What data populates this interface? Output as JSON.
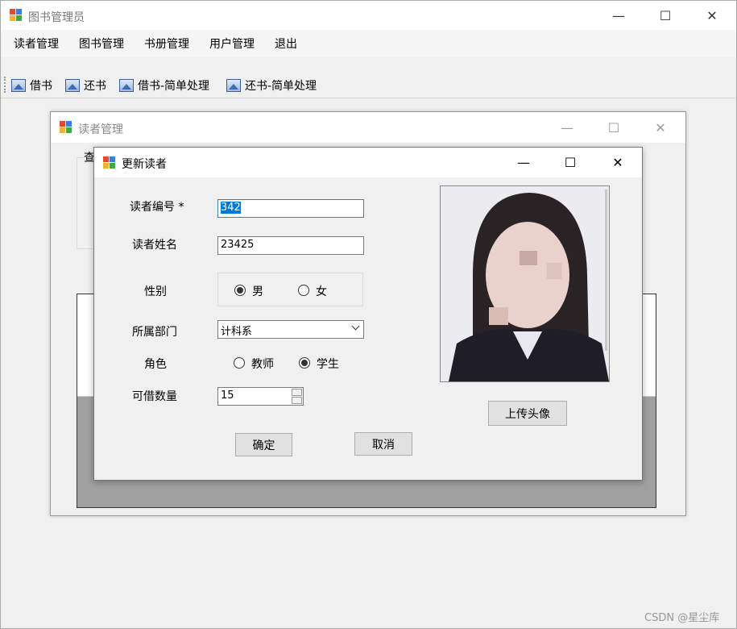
{
  "main_window": {
    "title": "图书管理员",
    "min": "—",
    "max": "☐",
    "close": "✕"
  },
  "menu": [
    "读者管理",
    "图书管理",
    "书册管理",
    "用户管理",
    "退出"
  ],
  "toolbar": [
    "借书",
    "还书",
    "借书-简单处理",
    "还书-简单处理"
  ],
  "reader_window": {
    "title": "读者管理",
    "query_label": "查",
    "min": "—",
    "max": "☐",
    "close": "✕"
  },
  "dialog": {
    "title": "更新读者",
    "min": "—",
    "max": "☐",
    "close": "✕",
    "fields": {
      "reader_id_label": "读者编号 *",
      "reader_id_value": "342",
      "reader_name_label": "读者姓名",
      "reader_name_value": "23425",
      "gender_label": "性别",
      "gender_male": "男",
      "gender_female": "女",
      "gender_selected": "男",
      "dept_label": "所属部门",
      "dept_value": "计科系",
      "role_label": "角色",
      "role_teacher": "教师",
      "role_student": "学生",
      "role_selected": "学生",
      "quota_label": "可借数量",
      "quota_value": "15"
    },
    "upload_label": "上传头像",
    "ok_label": "确定",
    "cancel_label": "取消"
  },
  "watermark": "CSDN @星尘库",
  "colors": {
    "window_bg": "#f0f0f0",
    "selection": "#0078d7",
    "grid_dark": "#a0a0a0"
  }
}
